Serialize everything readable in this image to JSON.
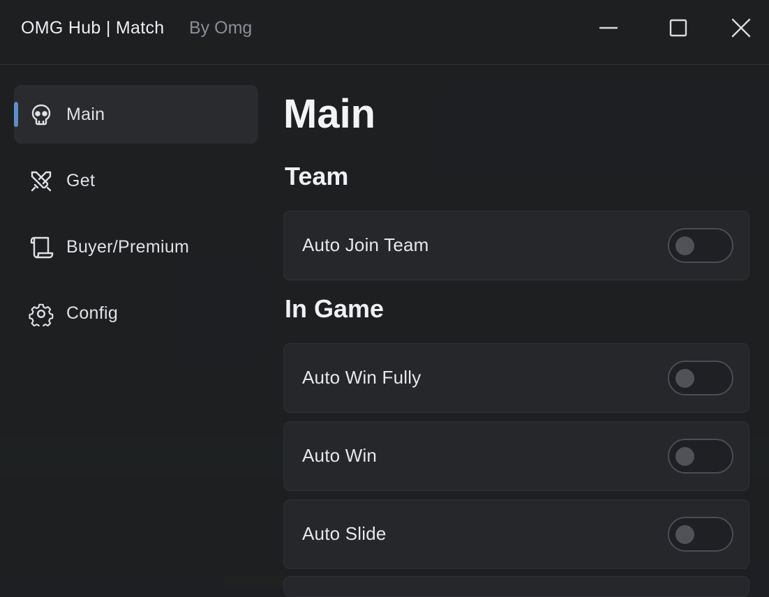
{
  "window": {
    "title": "OMG Hub | Match",
    "subtitle": "By Omg",
    "controls": {
      "minimize": "minimize-icon",
      "maximize": "maximize-icon",
      "close": "close-icon"
    }
  },
  "sidebar": {
    "items": [
      {
        "label": "Main",
        "icon": "skull-icon",
        "active": true
      },
      {
        "label": "Get",
        "icon": "crossed-swords-icon",
        "active": false
      },
      {
        "label": "Buyer/Premium",
        "icon": "scroll-icon",
        "active": false
      },
      {
        "label": "Config",
        "icon": "gear-icon",
        "active": false
      }
    ]
  },
  "main": {
    "title": "Main",
    "sections": [
      {
        "title": "Team",
        "toggles": [
          {
            "label": "Auto Join Team",
            "on": false
          }
        ]
      },
      {
        "title": "In Game",
        "toggles": [
          {
            "label": "Auto Win Fully",
            "on": false
          },
          {
            "label": "Auto Win",
            "on": false
          },
          {
            "label": "Auto Slide",
            "on": false
          }
        ]
      }
    ]
  },
  "colors": {
    "accent": "#5b8ec9",
    "background": "#1e1f22",
    "card": "#26272b"
  }
}
